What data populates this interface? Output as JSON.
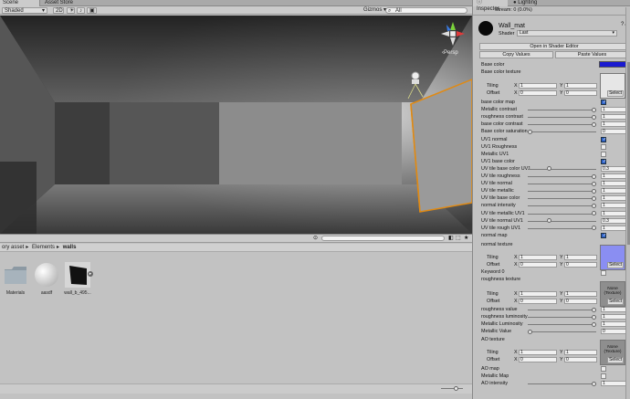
{
  "scene": {
    "tabs": [
      "Scene",
      "Asset Store"
    ],
    "shading_mode": "Shaded",
    "mode_2d": "2D",
    "gizmos": "Gizmos",
    "search_placeholder": "All",
    "persp_label": "‹Persp"
  },
  "project": {
    "breadcrumbs": [
      "ory asset",
      "Elements",
      "walls"
    ],
    "assets": [
      {
        "label": "Materials",
        "kind": "folder"
      },
      {
        "label": "aasdf",
        "kind": "sphere"
      },
      {
        "label": "wall_b_495...",
        "kind": "dark"
      }
    ]
  },
  "inspector": {
    "tabs": [
      "Inspector",
      "Lighting"
    ],
    "stream_text": "Stream: 0 (0.0%)",
    "material_name": "Wall_mat",
    "shader_label": "Shader",
    "shader_value": "Last",
    "open_shader_button": "Open in Shader Editor",
    "copy_button": "Copy Values",
    "paste_button": "Paste Values",
    "base_color_label": "Base color",
    "base_color_value": "#1a1ad0",
    "base_color_texture_label": "Base color texture",
    "tiling_label": "Tiling",
    "offset_label": "Offset",
    "x_label": "X",
    "y_label": "Y",
    "select_label": "Select",
    "none_texture_label": "None (Texture)",
    "texture_sets": [
      {
        "tiling_x": "1",
        "tiling_y": "1",
        "offset_x": "0",
        "offset_y": "0"
      },
      {
        "tiling_x": "1",
        "tiling_y": "1",
        "offset_x": "0",
        "offset_y": "0"
      },
      {
        "tiling_x": "1",
        "tiling_y": "1",
        "offset_x": "0",
        "offset_y": "0"
      },
      {
        "tiling_x": "1",
        "tiling_y": "1",
        "offset_x": "0",
        "offset_y": "0"
      }
    ],
    "props_a": [
      {
        "label": "base color map",
        "type": "check",
        "checked": true
      },
      {
        "label": "Metallic contrast",
        "type": "slider",
        "value": "1"
      },
      {
        "label": "roughness contrast",
        "type": "slider",
        "value": "1"
      },
      {
        "label": "base color contrast",
        "type": "slider",
        "value": "1"
      },
      {
        "label": "Base color saturation",
        "type": "slider",
        "value": "0"
      },
      {
        "label": "UV1 normal",
        "type": "check",
        "checked": true
      },
      {
        "label": "UV1 Roughness",
        "type": "check",
        "checked": false
      },
      {
        "label": "Metallic UV1",
        "type": "check",
        "checked": false
      },
      {
        "label": "UV1 base color",
        "type": "check",
        "checked": true
      },
      {
        "label": "UV tile base color UV1",
        "type": "slider",
        "value": "0.3"
      },
      {
        "label": "UV tile roughness",
        "type": "slider",
        "value": "1"
      },
      {
        "label": "UV tile normal",
        "type": "slider",
        "value": "1"
      },
      {
        "label": "UV tile metallic",
        "type": "slider",
        "value": "1"
      },
      {
        "label": "UV tile base color",
        "type": "slider",
        "value": "1"
      },
      {
        "label": "normal intensity",
        "type": "slider",
        "value": "1"
      },
      {
        "label": "UV tile metallic UV1",
        "type": "slider",
        "value": "1"
      },
      {
        "label": "UV tile normal UV1",
        "type": "slider",
        "value": "0.3"
      },
      {
        "label": "UV tile rough UV1",
        "type": "slider",
        "value": "1"
      },
      {
        "label": "normal map",
        "type": "check",
        "checked": true
      }
    ],
    "normal_texture_label": "normal texture",
    "keyword_label": "Keyword 0",
    "roughness_texture_label": "roughness texture",
    "props_b": [
      {
        "label": "roughness value",
        "type": "slider",
        "value": "1"
      },
      {
        "label": "roughness luminosity",
        "type": "slider",
        "value": "1"
      },
      {
        "label": "Metallic Luminosity",
        "type": "slider",
        "value": "1"
      },
      {
        "label": "Metallic Value",
        "type": "slider",
        "value": "0"
      }
    ],
    "ao_texture_label": "AO texture",
    "props_c": [
      {
        "label": "AO map",
        "type": "check",
        "checked": false
      },
      {
        "label": "Metallic Map",
        "type": "check",
        "checked": false
      },
      {
        "label": "AO intensity",
        "type": "slider",
        "value": "1"
      }
    ]
  }
}
